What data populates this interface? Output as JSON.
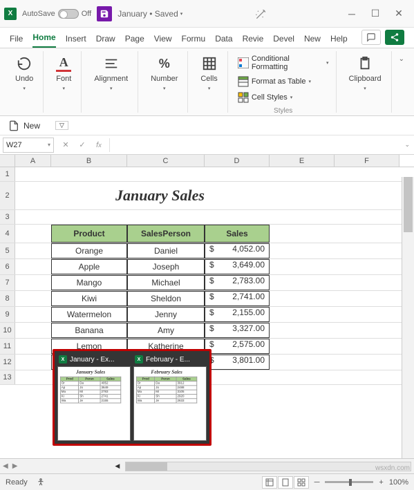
{
  "titlebar": {
    "autosave": "AutoSave",
    "off": "Off",
    "doc": "January • Saved"
  },
  "tabs": {
    "file": "File",
    "home": "Home",
    "insert": "Insert",
    "draw": "Draw",
    "page": "Page",
    "view": "View",
    "formu": "Formu",
    "data": "Data",
    "revie": "Revie",
    "devel": "Devel",
    "new": "New",
    "help": "Help"
  },
  "ribbon": {
    "undo": "Undo",
    "font": "Font",
    "alignment": "Alignment",
    "number": "Number",
    "cells": "Cells",
    "cf": "Conditional Formatting",
    "fat": "Format as Table",
    "cs": "Cell Styles",
    "styles": "Styles",
    "clipboard": "Clipboard"
  },
  "quick": {
    "new": "New"
  },
  "namebox": "W27",
  "cols": {
    "A": "A",
    "B": "B",
    "C": "C",
    "D": "D",
    "E": "E",
    "F": "F"
  },
  "sheet": {
    "title": "January Sales",
    "headers": {
      "product": "Product",
      "salesperson": "SalesPerson",
      "sales": "Sales"
    },
    "rows": [
      {
        "product": "Orange",
        "person": "Daniel",
        "sales": "4,052.00"
      },
      {
        "product": "Apple",
        "person": "Joseph",
        "sales": "3,649.00"
      },
      {
        "product": "Mango",
        "person": "Michael",
        "sales": "2,783.00"
      },
      {
        "product": "Kiwi",
        "person": "Sheldon",
        "sales": "2,741.00"
      },
      {
        "product": "Watermelon",
        "person": "Jenny",
        "sales": "2,155.00"
      },
      {
        "product": "Banana",
        "person": "Amy",
        "sales": "3,327.00"
      },
      {
        "product": "Lemon",
        "person": "Katherine",
        "sales": "2,575.00"
      },
      {
        "product": "",
        "person": "",
        "sales": "3,801.00"
      }
    ],
    "currency": "$"
  },
  "taskbar": {
    "jan": "January - Ex...",
    "feb": "February - E...",
    "thumbJan": "January Sales",
    "thumbFeb": "February Sales"
  },
  "status": {
    "ready": "Ready",
    "zoom": "100%"
  },
  "watermark": "wsxdn.com"
}
